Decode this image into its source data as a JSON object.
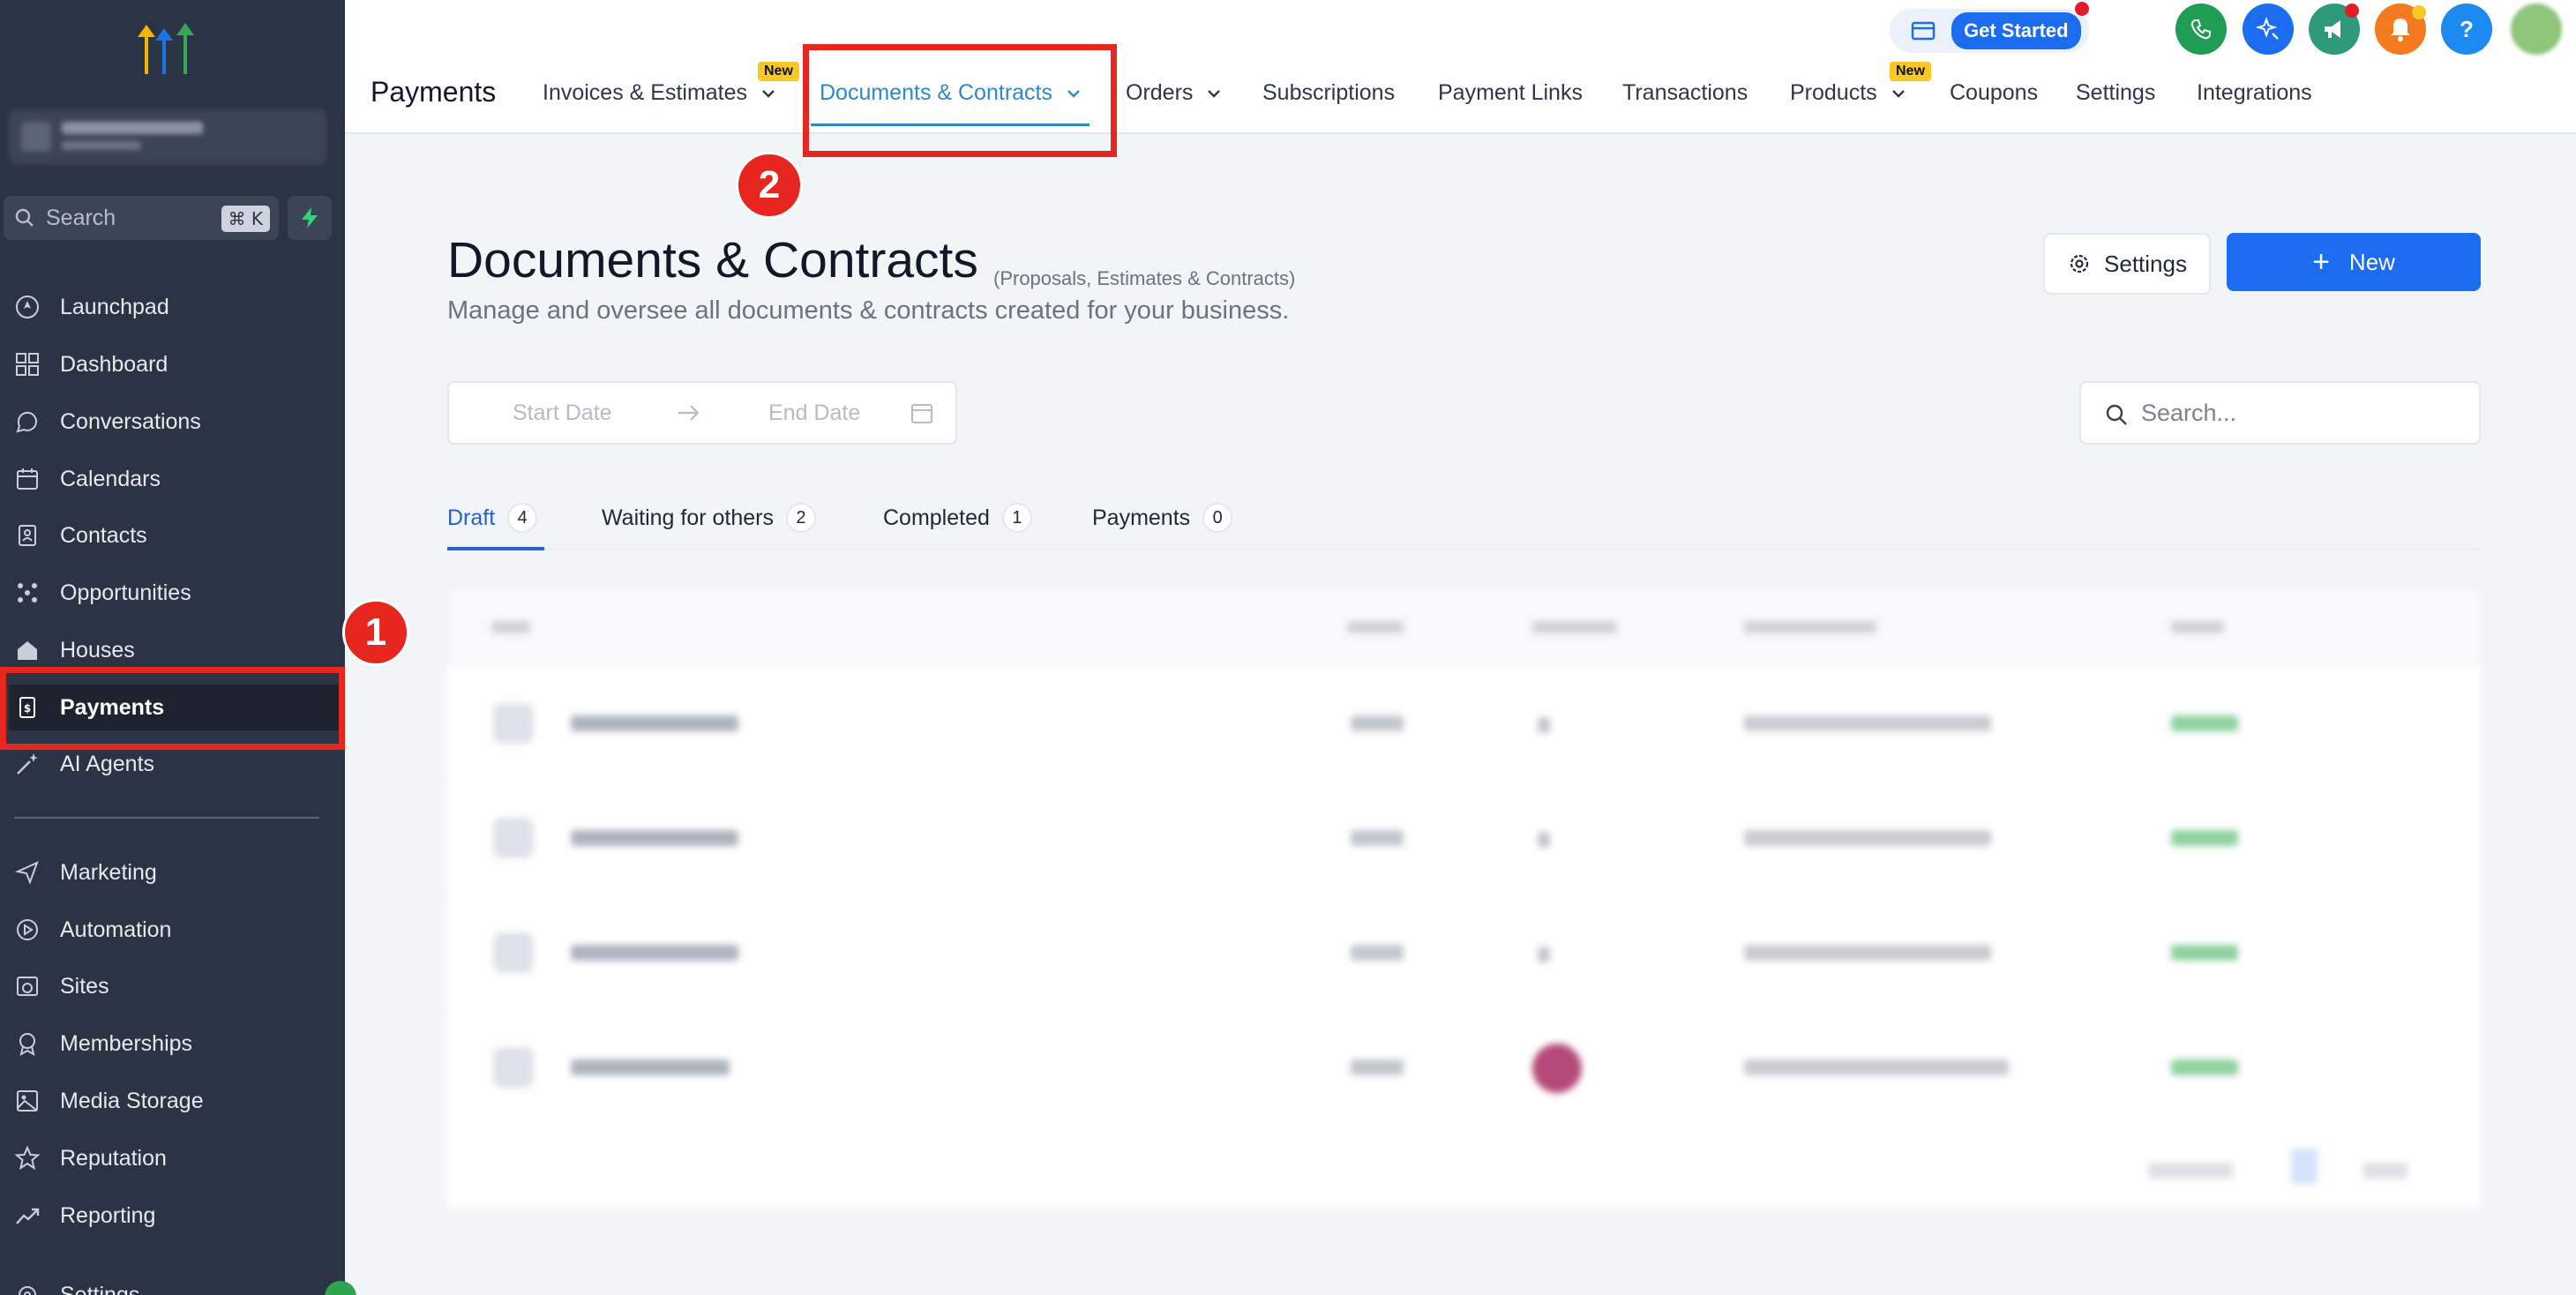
{
  "sidebar": {
    "search_placeholder": "Search",
    "search_shortcut": "⌘ K",
    "items": [
      {
        "label": "Launchpad"
      },
      {
        "label": "Dashboard"
      },
      {
        "label": "Conversations"
      },
      {
        "label": "Calendars"
      },
      {
        "label": "Contacts"
      },
      {
        "label": "Opportunities"
      },
      {
        "label": "Houses"
      },
      {
        "label": "Payments"
      },
      {
        "label": "AI Agents"
      },
      {
        "label": "Marketing"
      },
      {
        "label": "Automation"
      },
      {
        "label": "Sites"
      },
      {
        "label": "Memberships"
      },
      {
        "label": "Media Storage"
      },
      {
        "label": "Reputation"
      },
      {
        "label": "Reporting"
      },
      {
        "label": "Settings"
      }
    ]
  },
  "topbar": {
    "title": "Payments",
    "tabs": [
      {
        "label": "Invoices & Estimates",
        "badge": "New"
      },
      {
        "label": "Documents & Contracts"
      },
      {
        "label": "Orders"
      },
      {
        "label": "Subscriptions"
      },
      {
        "label": "Payment Links"
      },
      {
        "label": "Transactions"
      },
      {
        "label": "Products",
        "badge": "New"
      },
      {
        "label": "Coupons"
      },
      {
        "label": "Settings"
      },
      {
        "label": "Integrations"
      }
    ],
    "get_started": "Get Started",
    "help": "?"
  },
  "main": {
    "title": "Documents & Contracts",
    "subtitle": "(Proposals, Estimates & Contracts)",
    "description": "Manage and oversee all documents & contracts created for your business.",
    "settings_button": "Settings",
    "new_button": "New",
    "start_date_placeholder": "Start Date",
    "end_date_placeholder": "End Date",
    "search_placeholder": "Search...",
    "subtabs": [
      {
        "label": "Draft",
        "count": "4"
      },
      {
        "label": "Waiting for others",
        "count": "2"
      },
      {
        "label": "Completed",
        "count": "1"
      },
      {
        "label": "Payments",
        "count": "0"
      }
    ]
  },
  "annotations": {
    "marker1": "1",
    "marker2": "2"
  },
  "colors": {
    "sidebar_bg": "#2b3444",
    "accent_blue": "#1c6cf0",
    "tab_active": "#2f88c8",
    "highlight_red": "#e6261f"
  }
}
